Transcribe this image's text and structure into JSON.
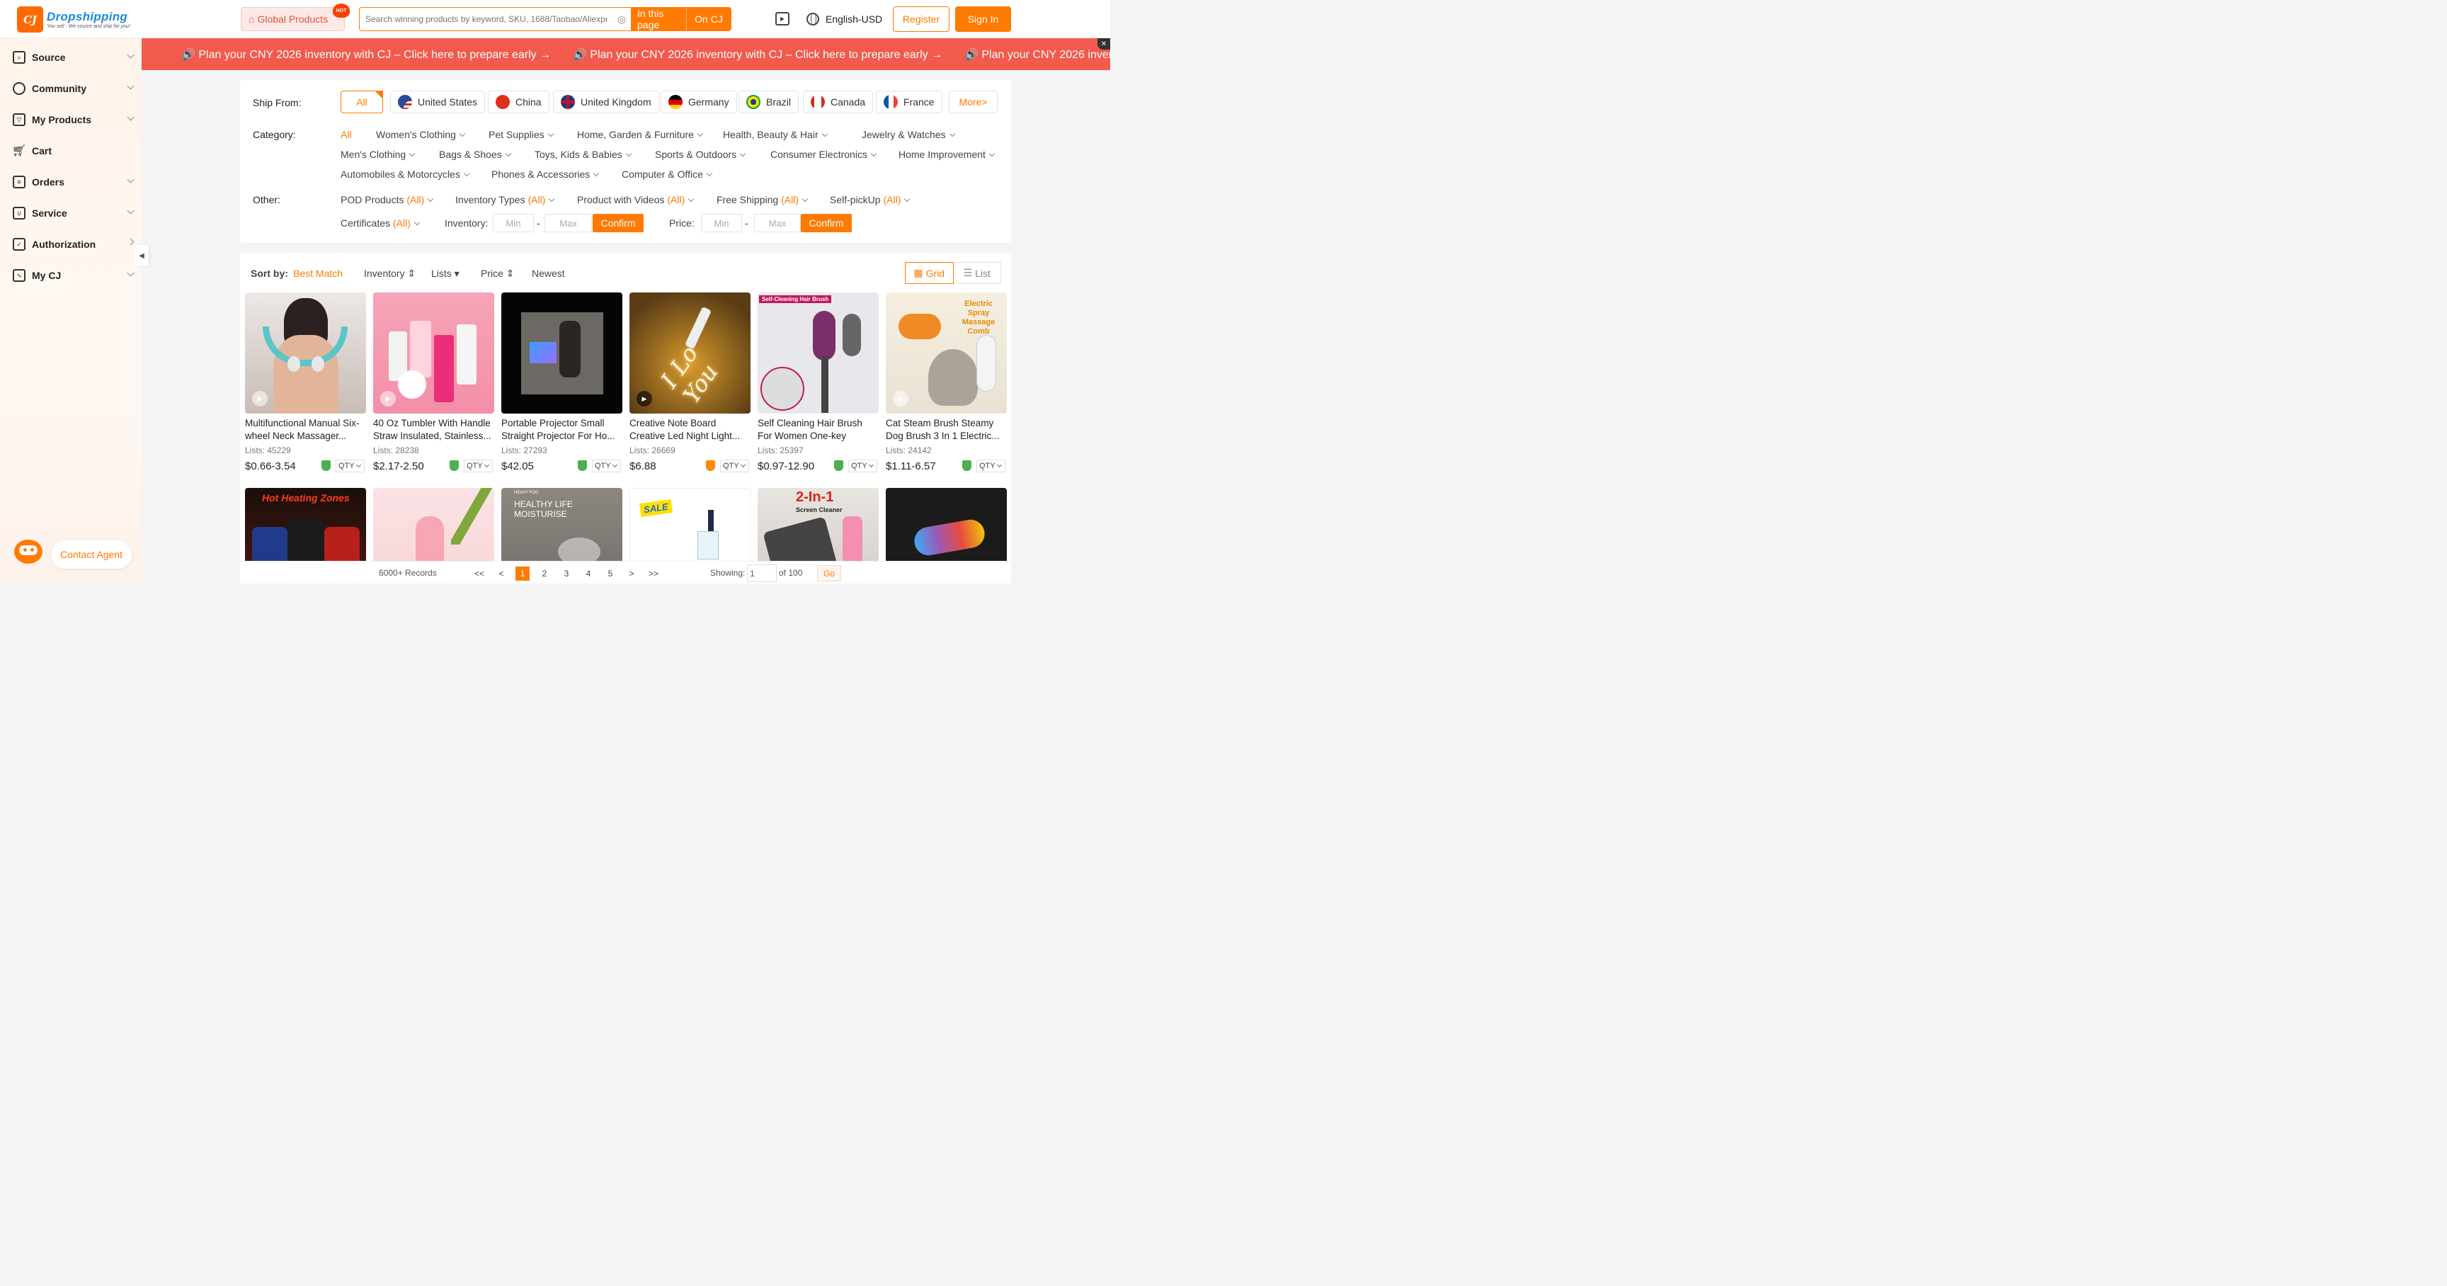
{
  "header": {
    "logo_mark": "CJ",
    "logo_name": "Dropshipping",
    "logo_tagline": "You sell - We source and ship for you!",
    "global_products": "Global Products",
    "hot_badge": "HOT",
    "search_placeholder": "Search winning products by keyword, SKU, 1688/Taobao/Aliexpr...",
    "search_in_page": "In this page",
    "search_on_cj": "On CJ",
    "language": "English-USD",
    "register": "Register",
    "sign_in": "Sign In"
  },
  "sidebar": {
    "items": [
      {
        "label": "Source",
        "icon": "search-box-icon",
        "chevron": "down"
      },
      {
        "label": "Community",
        "icon": "planet-icon",
        "chevron": "down"
      },
      {
        "label": "My Products",
        "icon": "product-box-icon",
        "chevron": "down"
      },
      {
        "label": "Cart",
        "icon": "cart-icon",
        "chevron": ""
      },
      {
        "label": "Orders",
        "icon": "orders-icon",
        "chevron": "down"
      },
      {
        "label": "Service",
        "icon": "service-icon",
        "chevron": "down"
      },
      {
        "label": "Authorization",
        "icon": "authorization-icon",
        "chevron": "right"
      },
      {
        "label": "My CJ",
        "icon": "dashboard-icon",
        "chevron": "down"
      }
    ],
    "contact_agent": "Contact Agent"
  },
  "banner": {
    "text": "🔊 Plan your CNY 2026 inventory with CJ – Click here to prepare early →"
  },
  "filters": {
    "ship_from_label": "Ship From:",
    "countries": [
      "All",
      "United States",
      "China",
      "United Kingdom",
      "Germany",
      "Brazil",
      "Canada",
      "France"
    ],
    "more": "More>",
    "category_label": "Category:",
    "categories_row1": [
      "All",
      "Women's Clothing",
      "Pet Supplies",
      "Home, Garden & Furniture",
      "Health, Beauty & Hair",
      "Jewelry & Watches"
    ],
    "categories_row2": [
      "Men's Clothing",
      "Bags & Shoes",
      "Toys, Kids & Babies",
      "Sports & Outdoors",
      "Consumer Electronics",
      "Home Improvement"
    ],
    "categories_row3": [
      "Automobiles & Motorcycles",
      "Phones & Accessories",
      "Computer & Office"
    ],
    "other_label": "Other:",
    "other_row1": [
      "POD Products",
      "Inventory Types",
      "Product with Videos",
      "Free Shipping",
      "Self-pickUp"
    ],
    "other_all": "(All)",
    "certificates": "Certificates",
    "inventory_label": "Inventory:",
    "price_label": "Price:",
    "min": "Min",
    "max": "Max",
    "confirm": "Confirm"
  },
  "sort": {
    "label": "Sort by:",
    "options": [
      "Best Match",
      "Inventory",
      "Lists",
      "Price",
      "Newest"
    ],
    "grid": "Grid",
    "list": "List"
  },
  "products": [
    {
      "name": "Multifunctional Manual Six-wheel Neck Massager...",
      "lists": "Lists: 45229",
      "price": "$0.66-3.54",
      "shield": "green"
    },
    {
      "name": "40 Oz Tumbler With Handle Straw Insulated, Stainless...",
      "lists": "Lists: 28238",
      "price": "$2.17-2.50",
      "shield": "green"
    },
    {
      "name": "Portable Projector Small Straight Projector For Ho...",
      "lists": "Lists: 27293",
      "price": "$42.05",
      "shield": "green"
    },
    {
      "name": "Creative Note Board Creative Led Night Light...",
      "lists": "Lists: 26669",
      "price": "$6.88",
      "shield": "orange"
    },
    {
      "name": "Self Cleaning Hair Brush For Women One-key Cleaning...",
      "lists": "Lists: 25397",
      "price": "$0.97-12.90",
      "shield": "green"
    },
    {
      "name": "Cat Steam Brush Steamy Dog Brush 3 In 1 Electric...",
      "lists": "Lists: 24142",
      "price": "$1.11-6.57",
      "shield": "green"
    }
  ],
  "product_images": {
    "hair_brush_caption": "Self-Cleaning Hair Brush",
    "cat_brush_caption": "Electric Spray Massage Comb",
    "night_light_text": "I Lo You",
    "jacket_caption": "Hot Heating Zones",
    "humidifier_caption_small": "HEAVY FOG",
    "humidifier_caption": "HEALTHY LIFE MOISTURISE",
    "sale_badge": "SALE",
    "screen_cleaner_big": "2-In-1",
    "screen_cleaner_small": "Screen Cleaner"
  },
  "qty_label": "QTY",
  "pager": {
    "records": "6000+ Records",
    "first": "<<",
    "prev": "<",
    "pages": [
      "1",
      "2",
      "3",
      "4",
      "5"
    ],
    "next": ">",
    "last": ">>",
    "showing_label": "Showing:",
    "showing_value": "1",
    "of_total": "of 100",
    "go": "Go"
  }
}
